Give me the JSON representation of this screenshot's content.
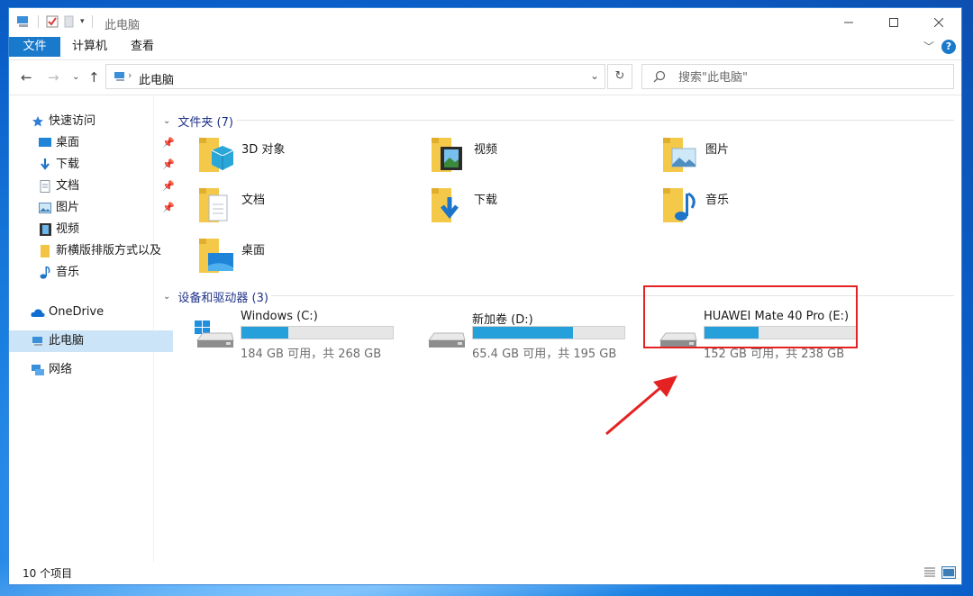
{
  "window": {
    "title": "此电脑"
  },
  "ribbon": {
    "tabs": [
      "文件",
      "计算机",
      "查看"
    ]
  },
  "address": {
    "path": "此电脑"
  },
  "search": {
    "placeholder": "搜索\"此电脑\""
  },
  "sidebar": {
    "quick_access": "快速访问",
    "items": [
      {
        "label": "桌面",
        "pinned": true
      },
      {
        "label": "下载",
        "pinned": true
      },
      {
        "label": "文档",
        "pinned": true
      },
      {
        "label": "图片",
        "pinned": true
      },
      {
        "label": "视频",
        "pinned": false
      },
      {
        "label": "新横版排版方式以及",
        "pinned": false
      },
      {
        "label": "音乐",
        "pinned": false
      }
    ],
    "onedrive": "OneDrive",
    "this_pc": "此电脑",
    "network": "网络"
  },
  "folders": {
    "header": "文件夹 (7)",
    "items": [
      "3D 对象",
      "视频",
      "图片",
      "文档",
      "下载",
      "音乐",
      "桌面"
    ]
  },
  "devices": {
    "header": "设备和驱动器 (3)",
    "items": [
      {
        "name": "Windows (C:)",
        "free": "184 GB 可用，共 268 GB",
        "used_fraction": 0.31
      },
      {
        "name": "新加卷 (D:)",
        "free": "65.4 GB 可用，共 195 GB",
        "used_fraction": 0.66
      },
      {
        "name": "HUAWEI Mate 40 Pro (E:)",
        "free": "152 GB 可用，共 238 GB",
        "used_fraction": 0.36
      }
    ]
  },
  "status": {
    "count": "10 个项目"
  },
  "colors": {
    "accent": "#1979ca",
    "bar_fill": "#26a0da",
    "highlight": "#e52222"
  }
}
